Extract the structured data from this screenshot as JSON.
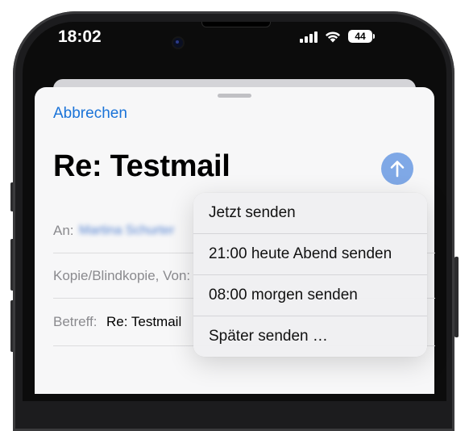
{
  "status_bar": {
    "time": "18:02",
    "battery": "44",
    "signal_icon": "cellular-signal-icon",
    "wifi_icon": "wifi-icon",
    "battery_icon": "battery-icon"
  },
  "compose": {
    "cancel_label": "Abbrechen",
    "subject_title": "Re: Testmail",
    "send_icon": "arrow-up-icon",
    "to_label": "An:",
    "to_value": "Martina Schurter",
    "cc_label": "Kopie/Blindkopie, Von:",
    "subject_label": "Betreff:",
    "subject_value": "Re: Testmail"
  },
  "send_menu": {
    "items": [
      {
        "label": "Jetzt senden"
      },
      {
        "label": "21:00 heute Abend senden"
      },
      {
        "label": "08:00 morgen senden"
      },
      {
        "label": "Später senden …"
      }
    ]
  },
  "colors": {
    "accent": "#1a73d8",
    "send_button": "#7fa8e6"
  }
}
